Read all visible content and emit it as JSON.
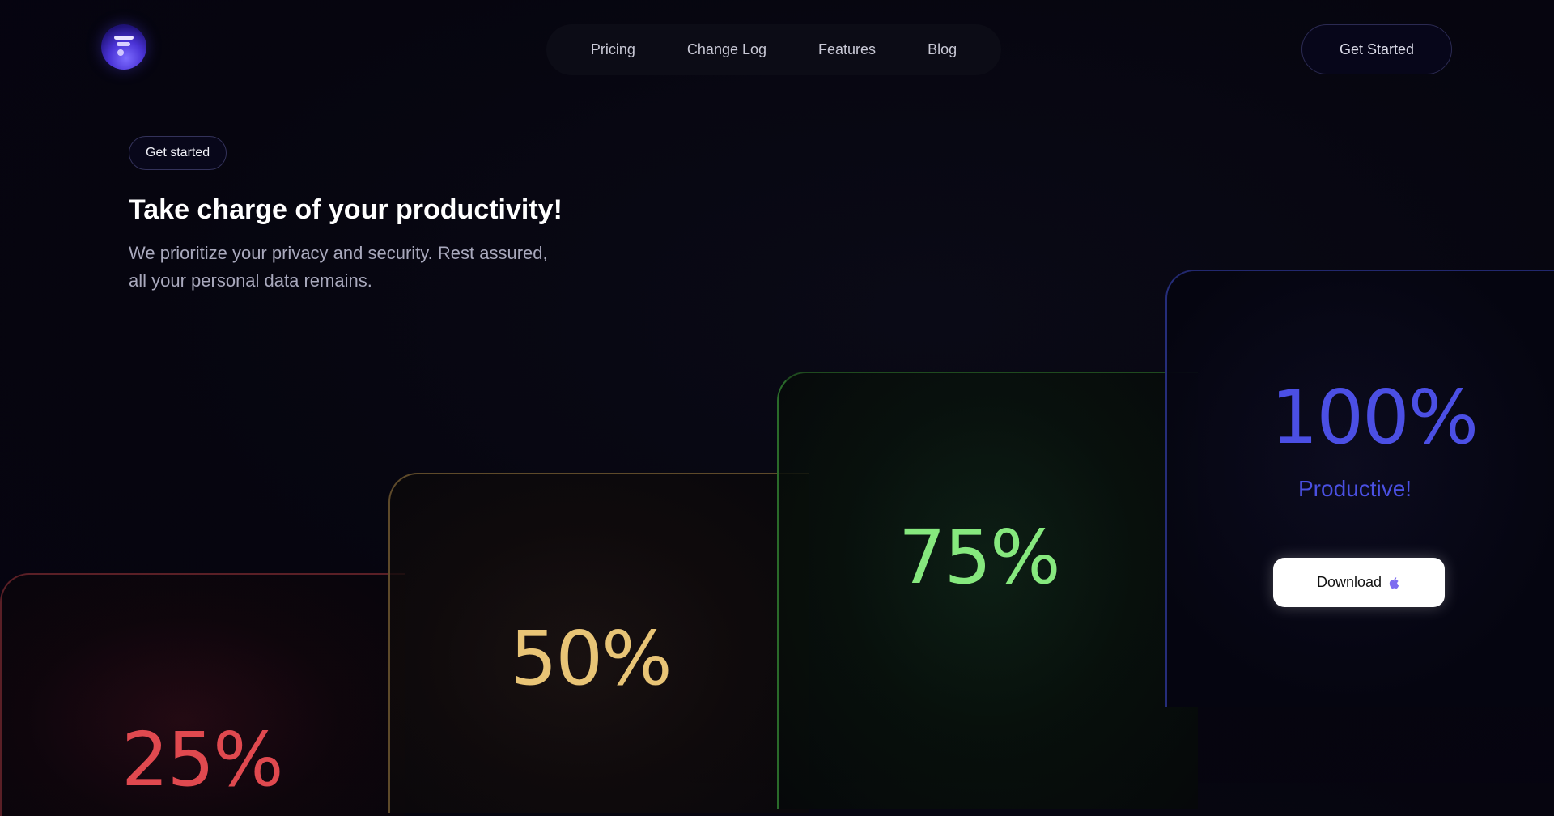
{
  "brand": {
    "logo_icon": "stacked-bars-logo-icon",
    "accent": "#4b4fe4"
  },
  "nav": {
    "items": [
      {
        "label": "Pricing"
      },
      {
        "label": "Change Log"
      },
      {
        "label": "Features"
      },
      {
        "label": "Blog"
      }
    ]
  },
  "header": {
    "cta_label": "Get Started"
  },
  "hero": {
    "pill_label": "Get started",
    "title": "Take charge of your productivity!",
    "subtitle": "We prioritize your privacy and security. Rest assured, all your personal data remains."
  },
  "cards": [
    {
      "value": "25%",
      "color": "#e0494f"
    },
    {
      "value": "50%",
      "color": "#e8c476"
    },
    {
      "value": "75%",
      "color": "#86e87e"
    },
    {
      "value": "100%",
      "color": "#4b4fe4",
      "caption": "Productive!",
      "button_label": "Download",
      "button_icon": "apple-icon"
    }
  ]
}
